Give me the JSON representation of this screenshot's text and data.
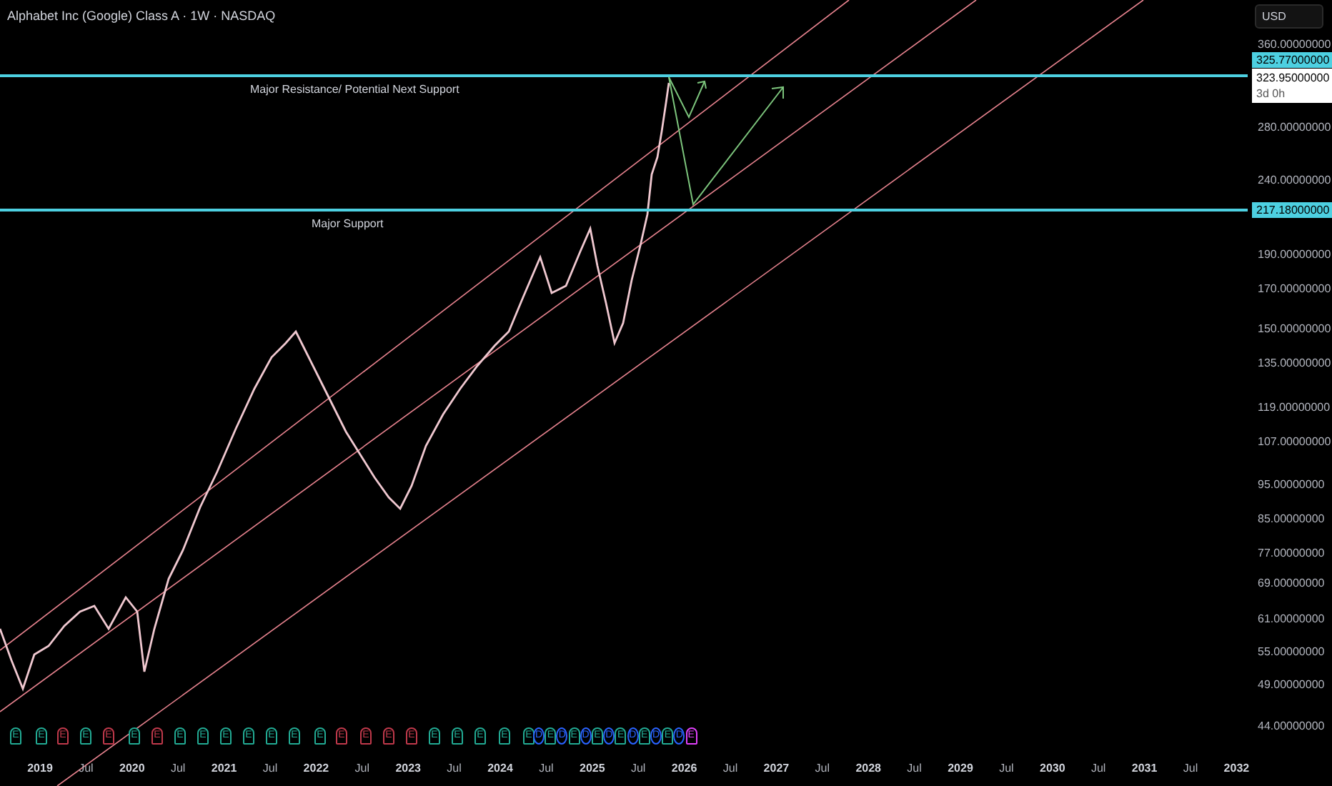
{
  "header": {
    "title": "Alphabet Inc (Google) Class A · 1W · NASDAQ"
  },
  "currency_button": {
    "label": "USD"
  },
  "levels": [
    {
      "kind": "resistance",
      "label": "Major Resistance/ Potential Next Support",
      "price_badge": "325.77000000"
    },
    {
      "kind": "support",
      "label": "Major Support",
      "price_badge": "217.18000000"
    }
  ],
  "last_price": {
    "price": "323.95000000",
    "countdown": "3d 0h"
  },
  "price_axis": {
    "labels": [
      "360.00000000",
      "280.00000000",
      "240.00000000",
      "190.00000000",
      "170.00000000",
      "150.00000000",
      "135.00000000",
      "119.00000000",
      "107.00000000",
      "95.00000000",
      "85.00000000",
      "77.00000000",
      "69.00000000",
      "61.00000000",
      "55.00000000",
      "49.00000000",
      "44.00000000"
    ]
  },
  "time_axis": {
    "labels": [
      "2019",
      "Jul",
      "2020",
      "Jul",
      "2021",
      "Jul",
      "2022",
      "Jul",
      "2023",
      "Jul",
      "2024",
      "Jul",
      "2025",
      "Jul",
      "2026",
      "Jul",
      "2027",
      "Jul",
      "2028",
      "Jul",
      "2029",
      "Jul",
      "2030",
      "Jul",
      "2031",
      "Jul",
      "2032"
    ]
  },
  "events": [
    {
      "kind": "earnings",
      "label": "E",
      "color": "#22ab94"
    },
    {
      "kind": "earnings",
      "label": "E",
      "color": "#22ab94"
    },
    {
      "kind": "earnings",
      "label": "E",
      "color": "#c0394b"
    },
    {
      "kind": "earnings",
      "label": "E",
      "color": "#22ab94"
    },
    {
      "kind": "earnings",
      "label": "E",
      "color": "#c0394b"
    },
    {
      "kind": "earnings",
      "label": "E",
      "color": "#22ab94"
    },
    {
      "kind": "earnings",
      "label": "E",
      "color": "#c0394b"
    },
    {
      "kind": "earnings",
      "label": "E",
      "color": "#22ab94"
    },
    {
      "kind": "earnings",
      "label": "E",
      "color": "#22ab94"
    },
    {
      "kind": "earnings",
      "label": "E",
      "color": "#22ab94"
    },
    {
      "kind": "earnings",
      "label": "E",
      "color": "#22ab94"
    },
    {
      "kind": "earnings",
      "label": "E",
      "color": "#22ab94"
    },
    {
      "kind": "earnings",
      "label": "E",
      "color": "#22ab94"
    },
    {
      "kind": "earnings",
      "label": "E",
      "color": "#22ab94"
    },
    {
      "kind": "earnings",
      "label": "E",
      "color": "#c0394b"
    },
    {
      "kind": "earnings",
      "label": "E",
      "color": "#c0394b"
    },
    {
      "kind": "earnings",
      "label": "E",
      "color": "#c0394b"
    },
    {
      "kind": "earnings",
      "label": "E",
      "color": "#c0394b"
    },
    {
      "kind": "earnings",
      "label": "E",
      "color": "#22ab94"
    },
    {
      "kind": "earnings",
      "label": "E",
      "color": "#22ab94"
    },
    {
      "kind": "earnings",
      "label": "E",
      "color": "#22ab94"
    },
    {
      "kind": "earnings",
      "label": "E",
      "color": "#22ab94"
    },
    {
      "kind": "earnings",
      "label": "E",
      "color": "#22ab94"
    },
    {
      "kind": "dividend",
      "label": "D",
      "color": "#2962ff"
    },
    {
      "kind": "earnings",
      "label": "E",
      "color": "#22ab94"
    },
    {
      "kind": "dividend",
      "label": "D",
      "color": "#2962ff"
    },
    {
      "kind": "earnings",
      "label": "E",
      "color": "#22ab94"
    },
    {
      "kind": "dividend",
      "label": "D",
      "color": "#2962ff"
    },
    {
      "kind": "earnings",
      "label": "E",
      "color": "#22ab94"
    },
    {
      "kind": "dividend",
      "label": "D",
      "color": "#2962ff"
    },
    {
      "kind": "earnings",
      "label": "E",
      "color": "#22ab94"
    },
    {
      "kind": "dividend",
      "label": "D",
      "color": "#2962ff"
    },
    {
      "kind": "earnings",
      "label": "E",
      "color": "#22ab94"
    },
    {
      "kind": "dividend",
      "label": "D",
      "color": "#2962ff"
    },
    {
      "kind": "earnings",
      "label": "E",
      "color": "#22ab94"
    },
    {
      "kind": "dividend",
      "label": "D",
      "color": "#2962ff"
    },
    {
      "kind": "earnings",
      "label": "E",
      "color": "#e040fb"
    }
  ]
}
